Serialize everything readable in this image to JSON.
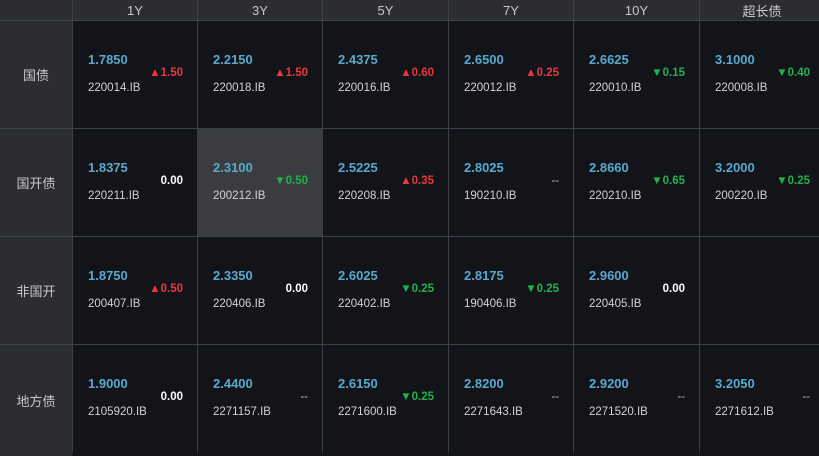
{
  "columns": [
    "1Y",
    "3Y",
    "5Y",
    "7Y",
    "10Y",
    "超长债"
  ],
  "rows": [
    {
      "label": "国债",
      "cells": [
        {
          "yield": "1.7850",
          "change": "▲1.50",
          "dir": "up",
          "code": "220014.IB"
        },
        {
          "yield": "2.2150",
          "change": "▲1.50",
          "dir": "up",
          "code": "220018.IB"
        },
        {
          "yield": "2.4375",
          "change": "▲0.60",
          "dir": "up",
          "code": "220016.IB"
        },
        {
          "yield": "2.6500",
          "change": "▲0.25",
          "dir": "up",
          "code": "220012.IB"
        },
        {
          "yield": "2.6625",
          "change": "▼0.15",
          "dir": "down",
          "code": "220010.IB"
        },
        {
          "yield": "3.1000",
          "change": "▼0.40",
          "dir": "down",
          "code": "220008.IB"
        }
      ]
    },
    {
      "label": "国开债",
      "cells": [
        {
          "yield": "1.8375",
          "change": "0.00",
          "dir": "flat",
          "code": "220211.IB"
        },
        {
          "yield": "2.3100",
          "change": "▼0.50",
          "dir": "down",
          "code": "200212.IB",
          "selected": true
        },
        {
          "yield": "2.5225",
          "change": "▲0.35",
          "dir": "up",
          "code": "220208.IB"
        },
        {
          "yield": "2.8025",
          "change": "--",
          "dir": "na",
          "code": "190210.IB"
        },
        {
          "yield": "2.8660",
          "change": "▼0.65",
          "dir": "down",
          "code": "220210.IB"
        },
        {
          "yield": "3.2000",
          "change": "▼0.25",
          "dir": "down",
          "code": "200220.IB"
        }
      ]
    },
    {
      "label": "非国开",
      "cells": [
        {
          "yield": "1.8750",
          "change": "▲0.50",
          "dir": "up",
          "code": "200407.IB"
        },
        {
          "yield": "2.3350",
          "change": "0.00",
          "dir": "flat",
          "code": "220406.IB"
        },
        {
          "yield": "2.6025",
          "change": "▼0.25",
          "dir": "down",
          "code": "220402.IB"
        },
        {
          "yield": "2.8175",
          "change": "▼0.25",
          "dir": "down",
          "code": "190406.IB"
        },
        {
          "yield": "2.9600",
          "change": "0.00",
          "dir": "flat",
          "code": "220405.IB"
        },
        {
          "yield": "",
          "change": "",
          "dir": "na",
          "code": ""
        }
      ]
    },
    {
      "label": "地方债",
      "cells": [
        {
          "yield": "1.9000",
          "change": "0.00",
          "dir": "flat",
          "code": "2105920.IB"
        },
        {
          "yield": "2.4400",
          "change": "--",
          "dir": "na",
          "code": "2271157.IB"
        },
        {
          "yield": "2.6150",
          "change": "▼0.25",
          "dir": "down",
          "code": "2271600.IB"
        },
        {
          "yield": "2.8200",
          "change": "--",
          "dir": "na",
          "code": "2271643.IB"
        },
        {
          "yield": "2.9200",
          "change": "--",
          "dir": "na",
          "code": "2271520.IB"
        },
        {
          "yield": "3.2050",
          "change": "--",
          "dir": "na",
          "code": "2271612.IB"
        }
      ]
    }
  ]
}
